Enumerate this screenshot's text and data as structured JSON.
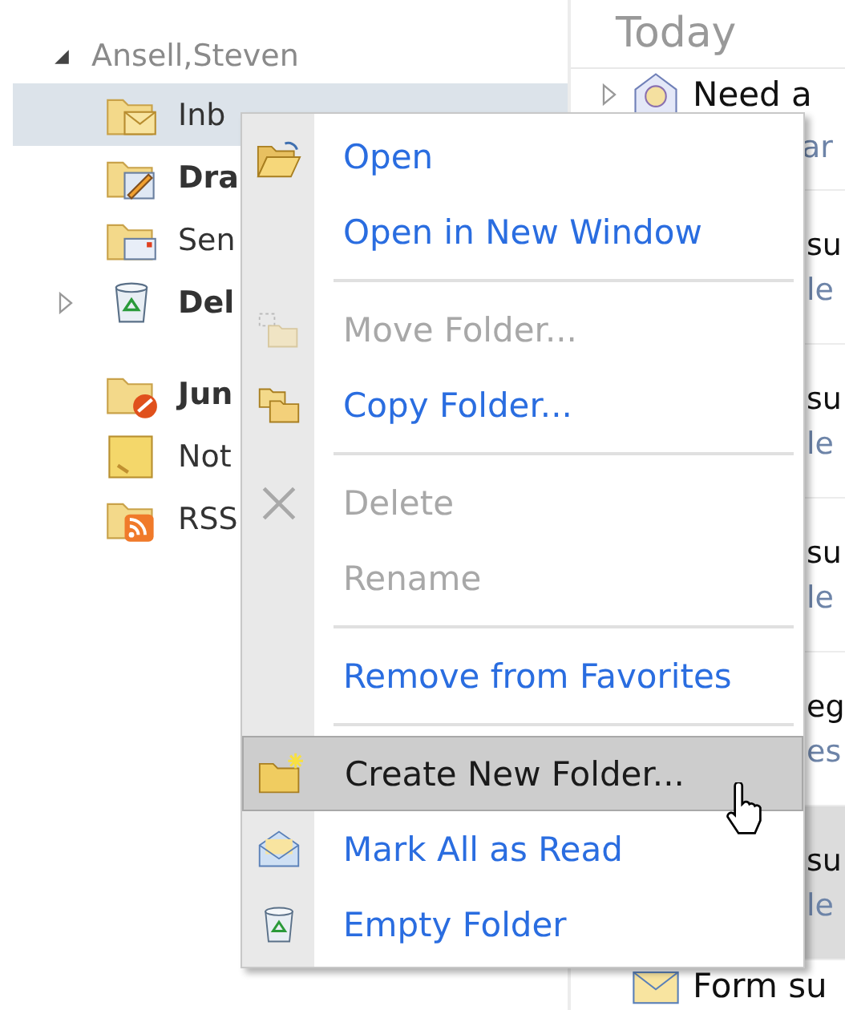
{
  "account": {
    "name": "Ansell,Steven",
    "expanded": true
  },
  "folder_groups": [
    {
      "items": [
        {
          "name": "Inb",
          "kind": "inbox",
          "bold": false,
          "selected": true,
          "has_subfolders": false
        },
        {
          "name": "Dra",
          "kind": "drafts",
          "bold": true,
          "selected": false,
          "has_subfolders": false
        },
        {
          "name": "Sen",
          "kind": "sent",
          "bold": false,
          "selected": false,
          "has_subfolders": false
        },
        {
          "name": "Del",
          "kind": "deleted",
          "bold": true,
          "selected": false,
          "has_subfolders": true
        }
      ]
    },
    {
      "items": [
        {
          "name": "Jun",
          "kind": "junk",
          "bold": true,
          "selected": false,
          "has_subfolders": false
        },
        {
          "name": "Not",
          "kind": "notes",
          "bold": false,
          "selected": false,
          "has_subfolders": false
        },
        {
          "name": "RSS",
          "kind": "rss",
          "bold": false,
          "selected": false,
          "has_subfolders": false
        }
      ]
    }
  ],
  "mail": {
    "header": "Today",
    "items": [
      {
        "kind": "full",
        "line1": "Need a",
        "line2": "ar",
        "selected": false
      },
      {
        "kind": "partial",
        "line1": "su",
        "line2": "le",
        "selected": false
      },
      {
        "kind": "partial",
        "line1": "su",
        "line2": "le",
        "selected": false
      },
      {
        "kind": "partial",
        "line1": "su",
        "line2": "le",
        "selected": false
      },
      {
        "kind": "partial",
        "line1": "eg",
        "line2": "es",
        "selected": false
      },
      {
        "kind": "partial",
        "line1": "su",
        "line2": "le",
        "selected": true
      },
      {
        "kind": "full",
        "line1": "Form su",
        "selected": false
      }
    ]
  },
  "context_menu": [
    {
      "kind": "item",
      "label": "Open",
      "disabled": false,
      "highlighted": false
    },
    {
      "kind": "item",
      "label": "Open in New Window",
      "disabled": false,
      "highlighted": false
    },
    {
      "kind": "separator"
    },
    {
      "kind": "item",
      "label": "Move Folder...",
      "disabled": true,
      "highlighted": false
    },
    {
      "kind": "item",
      "label": "Copy Folder...",
      "disabled": false,
      "highlighted": false
    },
    {
      "kind": "separator"
    },
    {
      "kind": "item",
      "label": "Delete",
      "disabled": true,
      "highlighted": false
    },
    {
      "kind": "item",
      "label": "Rename",
      "disabled": true,
      "highlighted": false
    },
    {
      "kind": "separator"
    },
    {
      "kind": "item",
      "label": "Remove from Favorites",
      "disabled": false,
      "highlighted": false
    },
    {
      "kind": "separator"
    },
    {
      "kind": "item",
      "label": "Create New Folder...",
      "disabled": false,
      "highlighted": true
    },
    {
      "kind": "item",
      "label": "Mark All as Read",
      "disabled": false,
      "highlighted": false
    },
    {
      "kind": "item",
      "label": "Empty Folder",
      "disabled": false,
      "highlighted": false
    }
  ]
}
